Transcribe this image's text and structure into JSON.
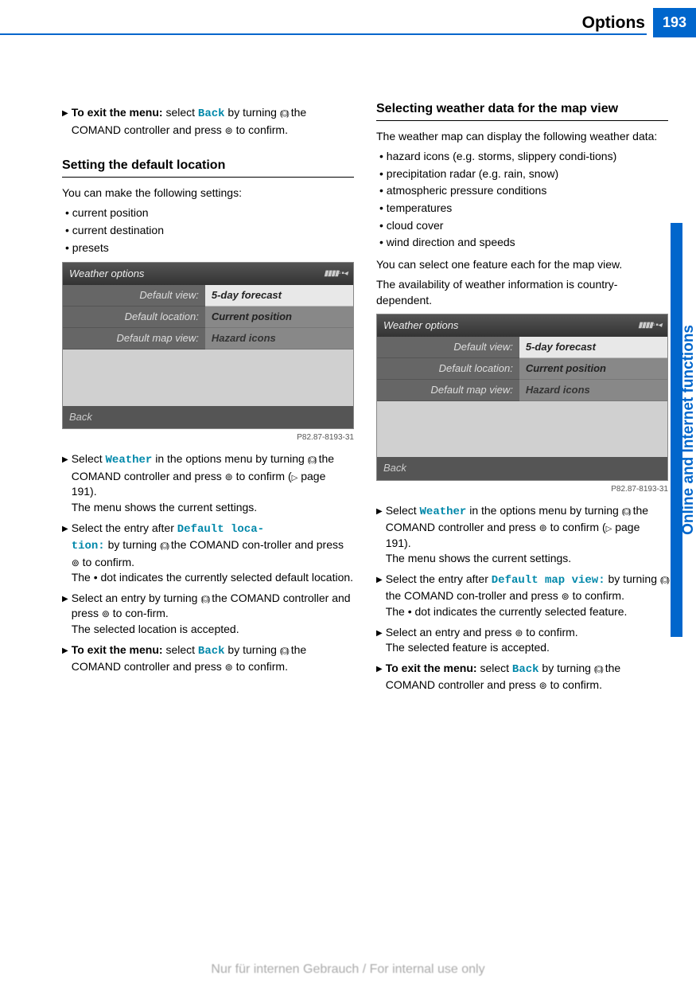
{
  "header": {
    "title": "Options",
    "page_number": "193"
  },
  "side_tab": "Online and Internet functions",
  "footer_watermark": "Nur für internen Gebrauch / For internal use only",
  "left": {
    "step_exit1": {
      "bold": "To exit the menu:",
      "rest1": " select ",
      "link": "Back",
      "rest2": " by turning ",
      "rest3": " the COMAND controller and press ",
      "rest4": " to confirm."
    },
    "heading1": "Setting the default location",
    "intro1": "You can make the following settings:",
    "bullets1": [
      "current position",
      "current destination",
      "presets"
    ],
    "screenshot": {
      "title": "Weather options",
      "rows": [
        {
          "label": "Default view:",
          "value": "5-day forecast"
        },
        {
          "label": "Default location:",
          "value": "Current position"
        },
        {
          "label": "Default map view:",
          "value": "Hazard icons"
        }
      ],
      "back": "Back",
      "caption": "P82.87-8193-31"
    },
    "step_select_weather": {
      "a": "Select ",
      "link": "Weather",
      "b": " in the options menu by turning ",
      "c": " the COMAND controller and press ",
      "d": " to confirm (",
      "e": " page 191).",
      "f": "The menu shows the current settings."
    },
    "step_default_loc": {
      "a": "Select the entry after ",
      "link": "Default loca-\ntion:",
      "b": " by turning ",
      "c": " the COMAND con-troller and press ",
      "d": " to confirm.",
      "e": "The • dot indicates the currently selected default location."
    },
    "step_select_entry": {
      "a": "Select an entry by turning ",
      "b": " the COMAND controller and press ",
      "c": " to con-firm.",
      "d": "The selected location is accepted."
    },
    "step_exit2": {
      "bold": "To exit the menu:",
      "a": " select ",
      "link": "Back",
      "b": " by turning ",
      "c": " the COMAND controller and press ",
      "d": " to confirm."
    }
  },
  "right": {
    "heading1": "Selecting weather data for the map view",
    "intro1": "The weather map can display the following weather data:",
    "bullets1": [
      "hazard icons (e.g. storms, slippery condi-tions)",
      "precipitation radar (e.g. rain, snow)",
      "atmospheric pressure conditions",
      "temperatures",
      "cloud cover",
      "wind direction and speeds"
    ],
    "para1": "You can select one feature each for the map view.",
    "para2": "The availability of weather information is country-dependent.",
    "screenshot": {
      "title": "Weather options",
      "rows": [
        {
          "label": "Default view:",
          "value": "5-day forecast"
        },
        {
          "label": "Default location:",
          "value": "Current position"
        },
        {
          "label": "Default map view:",
          "value": "Hazard icons"
        }
      ],
      "back": "Back",
      "caption": "P82.87-8193-31"
    },
    "step_select_weather": {
      "a": "Select ",
      "link": "Weather",
      "b": " in the options menu by turning ",
      "c": " the COMAND controller and press ",
      "d": " to confirm (",
      "e": " page 191).",
      "f": "The menu shows the current settings."
    },
    "step_default_map": {
      "a": "Select the entry after ",
      "link": "Default map view:",
      "b": " by turning ",
      "c": " the COMAND con-troller and press ",
      "d": " to confirm.",
      "e": "The • dot indicates the currently selected feature."
    },
    "step_select_entry": {
      "a": "Select an entry and press ",
      "b": " to confirm.",
      "c": "The selected feature is accepted."
    },
    "step_exit": {
      "bold": "To exit the menu:",
      "a": " select ",
      "link": "Back",
      "b": " by turning ",
      "c": " the COMAND controller and press ",
      "d": " to confirm."
    }
  }
}
